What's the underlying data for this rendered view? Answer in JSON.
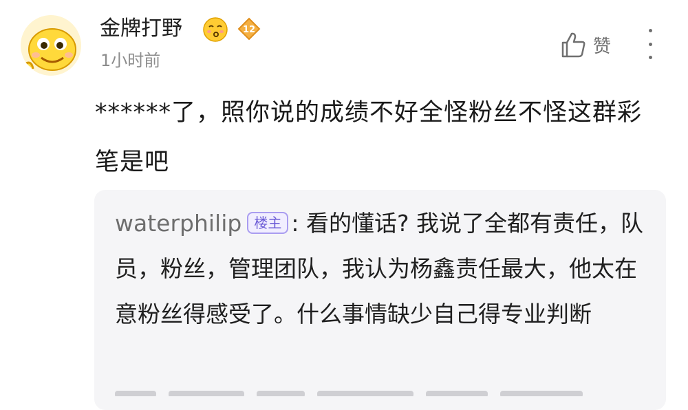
{
  "post": {
    "username": "金牌打野",
    "timestamp": "1小时前",
    "level": "12",
    "like_label": "赞",
    "comment_text": "******了，照你说的成绩不好全怪粉丝不怪这群彩笔是吧"
  },
  "reply": {
    "author": "waterphilip",
    "op_badge": "楼主",
    "separator": ":",
    "text": " 看的懂话? 我说了全都有责任，队员，粉丝，管理团队，我认为杨鑫责任最大，他太在意粉丝得感受了。什么事情缺少自己得专业判断"
  },
  "colors": {
    "background": "#ffffff",
    "reply_bg": "#f5f5f7",
    "op_badge": "#6b5bd6",
    "level_badge": "#f2a33a"
  },
  "icons": {
    "avatar": "smiley-avatar",
    "emoji": "kissing-face-icon",
    "level": "level-diamond-icon",
    "like": "thumbs-up-icon",
    "more": "more-vertical-icon"
  }
}
